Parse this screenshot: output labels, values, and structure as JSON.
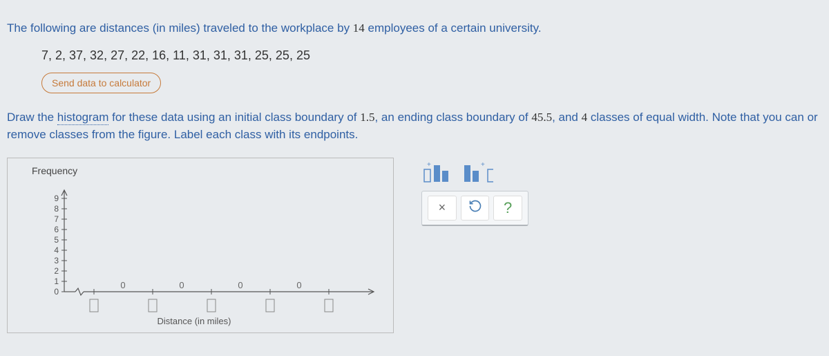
{
  "intro": {
    "prefix": "The following are distances (in miles) traveled to the workplace by ",
    "count": "14",
    "suffix": " employees of a certain university."
  },
  "data_list": "7, 2, 37, 32, 27, 22, 16, 11, 31, 31, 31, 25, 25, 25",
  "send_button": "Send data to calculator",
  "instruction": {
    "p1": "Draw the ",
    "histogram_word": "histogram",
    "p2": " for these data using an initial class boundary of ",
    "v1": "1.5",
    "p3": ", an ending class boundary of ",
    "v2": "45.5",
    "p4": ", and ",
    "v3": "4",
    "p5": " classes of equal width. Note that you can or remove classes from the figure. Label each class with its endpoints."
  },
  "chart": {
    "y_label": "Frequency",
    "x_label": "Distance (in miles)",
    "y_ticks": [
      "0",
      "1",
      "2",
      "3",
      "4",
      "5",
      "6",
      "7",
      "8",
      "9"
    ],
    "bar_labels": [
      "0",
      "0",
      "0",
      "0"
    ]
  },
  "chart_data": {
    "type": "bar",
    "title": "",
    "xlabel": "Distance (in miles)",
    "ylabel": "Frequency",
    "ylim": [
      0,
      9
    ],
    "categories": [
      "",
      "",
      "",
      ""
    ],
    "values": [
      0,
      0,
      0,
      0
    ]
  },
  "tools": {
    "add_bar": "add-bar",
    "remove_bar": "remove-bar",
    "close": "×",
    "reset": "↺",
    "help": "?"
  }
}
